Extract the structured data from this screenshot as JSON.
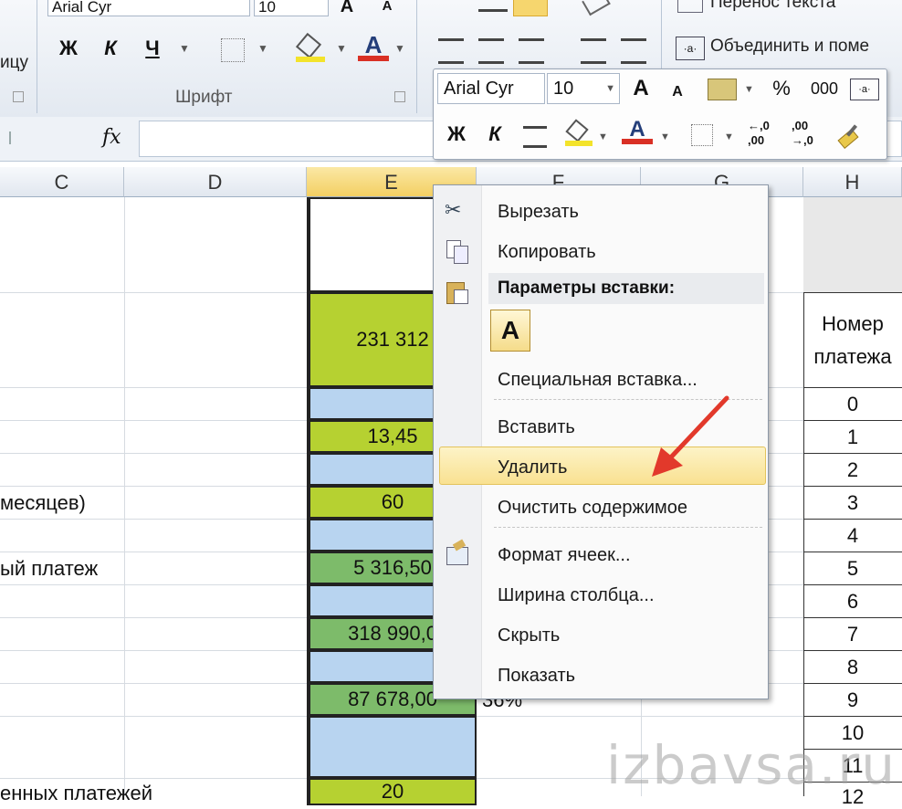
{
  "ribbon": {
    "font_name": "Arial Cyr",
    "font_size": "10",
    "bold": "Ж",
    "italic": "К",
    "underline": "Ч",
    "font_group_label": "Шрифт",
    "left_label": "ицу",
    "wrap_text": "Перенос текста",
    "merge": "Объединить и поме",
    "grow": "A",
    "shrink": "A",
    "font_color": "A"
  },
  "formula_bar": {
    "fx": "fx"
  },
  "columns": [
    "C",
    "D",
    "E",
    "F",
    "G",
    "H"
  ],
  "sheet": {
    "e_values": [
      "231 312",
      "13,45",
      "60",
      "5 316,50",
      "318 990,0",
      "87 678,00",
      "20"
    ],
    "c_labels": [
      "месяцев)",
      "ый платеж",
      "енных платежей"
    ],
    "f_value": "36%",
    "h_header": [
      "Номер",
      "платежа"
    ],
    "h_numbers": [
      "0",
      "1",
      "2",
      "3",
      "4",
      "5",
      "6",
      "7",
      "8",
      "9",
      "10",
      "11",
      "12"
    ]
  },
  "mini_toolbar": {
    "font_name": "Arial Cyr",
    "font_size": "10",
    "grow": "A",
    "shrink": "A",
    "percent": "%",
    "thousands": "000",
    "bold": "Ж",
    "italic": "К",
    "font_color": "A",
    "inc_decimal": "←,0\n,00",
    "dec_decimal": ",00\n→,0"
  },
  "context_menu": {
    "cut": "Вырезать",
    "copy": "Копировать",
    "paste_options": "Параметры вставки:",
    "paste_a": "A",
    "paste_special": "Специальная вставка...",
    "insert": "Вставить",
    "delete": "Удалить",
    "clear": "Очистить содержимое",
    "format_cells": "Формат ячеек...",
    "column_width": "Ширина столбца...",
    "hide": "Скрыть",
    "unhide": "Показать"
  },
  "colors": {
    "green": "#b6d131",
    "dark_green": "#7dbb6a",
    "blue": "#b8d4f0",
    "highlight": "#f9e191",
    "arrow": "#e2392b"
  },
  "watermark": "izbavsa.ru"
}
